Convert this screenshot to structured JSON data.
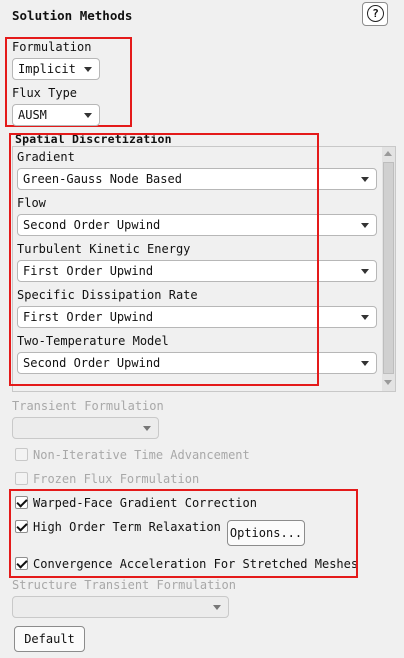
{
  "panel": {
    "title": "Solution Methods",
    "help_label": "?"
  },
  "formulation": {
    "label": "Formulation",
    "value": "Implicit"
  },
  "flux_type": {
    "label": "Flux Type",
    "value": "AUSM"
  },
  "spatial": {
    "header": "Spatial Discretization",
    "gradient": {
      "label": "Gradient",
      "value": "Green-Gauss Node Based"
    },
    "flow": {
      "label": "Flow",
      "value": "Second Order Upwind"
    },
    "tke": {
      "label": "Turbulent Kinetic Energy",
      "value": "First Order Upwind"
    },
    "sdr": {
      "label": "Specific Dissipation Rate",
      "value": "First Order Upwind"
    },
    "two_temp": {
      "label": "Two-Temperature Model",
      "value": "Second Order Upwind"
    }
  },
  "transient": {
    "label": "Transient Formulation",
    "value": ""
  },
  "checkboxes": {
    "non_iterative": {
      "label": "Non-Iterative Time Advancement",
      "checked": false
    },
    "frozen_flux": {
      "label": "Frozen Flux Formulation",
      "checked": false
    },
    "warped_face": {
      "label": "Warped-Face Gradient Correction",
      "checked": true
    },
    "high_order": {
      "label": "High Order Term Relaxation",
      "checked": true
    },
    "convergence": {
      "label": "Convergence Acceleration For Stretched Meshes",
      "checked": true
    }
  },
  "options_button": "Options...",
  "structure_transient": {
    "label": "Structure Transient Formulation",
    "value": ""
  },
  "default_button": "Default",
  "colors": {
    "highlight": "#e41a1a"
  }
}
